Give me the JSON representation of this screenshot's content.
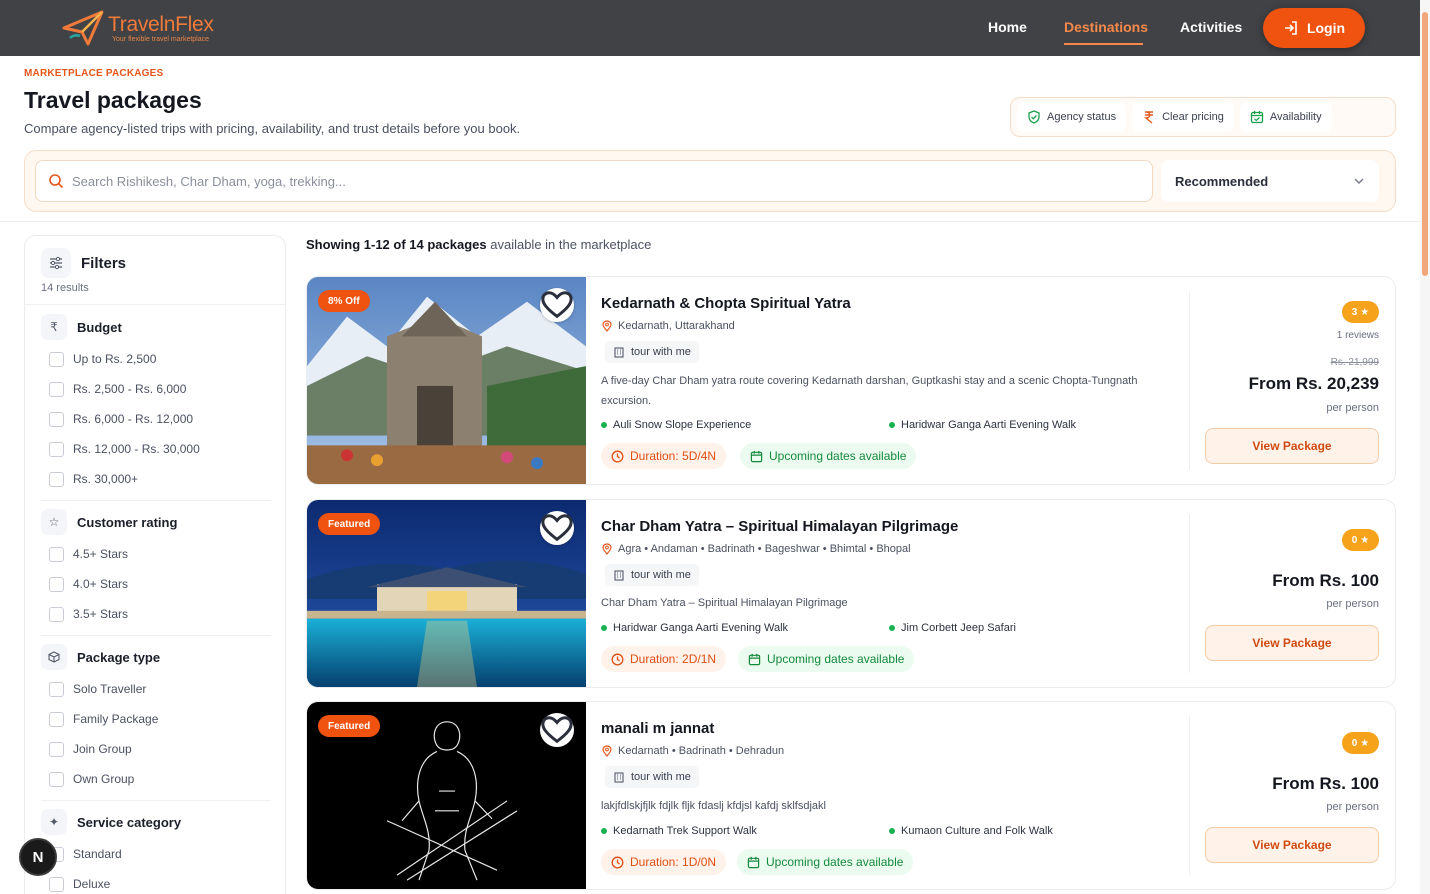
{
  "brand": {
    "name": "TravelnFlex",
    "tagline": "Your flexible travel marketplace"
  },
  "nav": {
    "links": [
      {
        "label": "Home"
      },
      {
        "label": "Destinations"
      },
      {
        "label": "Activities"
      }
    ],
    "active": "Destinations",
    "login_label": "Login"
  },
  "header": {
    "eyebrow": "MARKETPLACE PACKAGES",
    "title": "Travel packages",
    "subtitle": "Compare agency-listed trips with pricing, availability, and trust details before you book.",
    "trust": [
      {
        "label": "Agency status",
        "icon": "shield-check-icon"
      },
      {
        "label": "Clear pricing",
        "icon": "rupee-icon"
      },
      {
        "label": "Availability",
        "icon": "calendar-check-icon"
      }
    ]
  },
  "search": {
    "placeholder": "Search Rishikesh, Char Dham, yoga, trekking...",
    "sort_value": "Recommended"
  },
  "filters": {
    "title": "Filters",
    "count": "14 results",
    "budget": {
      "title": "Budget",
      "options": [
        "Up to Rs. 2,500",
        "Rs. 2,500 - Rs. 6,000",
        "Rs. 6,000 - Rs. 12,000",
        "Rs. 12,000 - Rs. 30,000",
        "Rs. 30,000+"
      ]
    },
    "rating": {
      "title": "Customer rating",
      "options": [
        "4.5+ Stars",
        "4.0+ Stars",
        "3.5+ Stars"
      ]
    },
    "package_type": {
      "title": "Package type",
      "options": [
        "Solo Traveller",
        "Family Package",
        "Join Group",
        "Own Group"
      ]
    },
    "service": {
      "title": "Service category",
      "options": [
        "Standard",
        "Deluxe"
      ]
    }
  },
  "results": {
    "showing_bold": "Showing 1-12 of 14 packages",
    "showing_rest": " available in the marketplace"
  },
  "packages": [
    {
      "badge": "8% Off",
      "title": "Kedarnath & Chopta Spiritual Yatra",
      "location": "Kedarnath, Uttarakhand",
      "agency": "tour with me",
      "description": "A five-day Char Dham yatra route covering Kedarnath darshan, Guptkashi stay and a scenic Chopta-Tungnath excursion.",
      "highlights": [
        "Auli Snow Slope Experience",
        "Haridwar Ganga Aarti Evening Walk"
      ],
      "duration": "Duration: 5D/4N",
      "availability": "Upcoming dates available",
      "rating": "3",
      "reviews": "1 reviews",
      "old_price": "Rs. 21,999",
      "price": "From Rs. 20,239",
      "per": "per person",
      "cta": "View Package"
    },
    {
      "badge": "Featured",
      "title": "Char Dham Yatra – Spiritual Himalayan Pilgrimage",
      "location": "Agra • Andaman • Badrinath • Bageshwar • Bhimtal • Bhopal",
      "agency": "tour with me",
      "description": "Char Dham Yatra – Spiritual Himalayan Pilgrimage",
      "highlights": [
        "Haridwar Ganga Aarti Evening Walk",
        "Jim Corbett Jeep Safari"
      ],
      "duration": "Duration: 2D/1N",
      "availability": "Upcoming dates available",
      "rating": "0",
      "price": "From Rs. 100",
      "per": "per person",
      "cta": "View Package"
    },
    {
      "badge": "Featured",
      "title": "manali m jannat",
      "location": "Kedarnath • Badrinath • Dehradun",
      "agency": "tour with me",
      "description": "lakjfdlskjfjlk fdjlk fljk fdaslj kfdjsl kafdj sklfsdjakl",
      "highlights": [
        "Kedarnath Trek Support Walk",
        "Kumaon Culture and Folk Walk"
      ],
      "duration": "Duration: 1D/0N",
      "availability": "Upcoming dates available",
      "rating": "0",
      "price": "From Rs. 100",
      "per": "per person",
      "cta": "View Package"
    }
  ],
  "fab": {
    "label": "N"
  },
  "colors": {
    "accent": "#f0520f",
    "nav_bg": "#414245",
    "success": "#19b24f",
    "rating": "#f7a21b"
  }
}
